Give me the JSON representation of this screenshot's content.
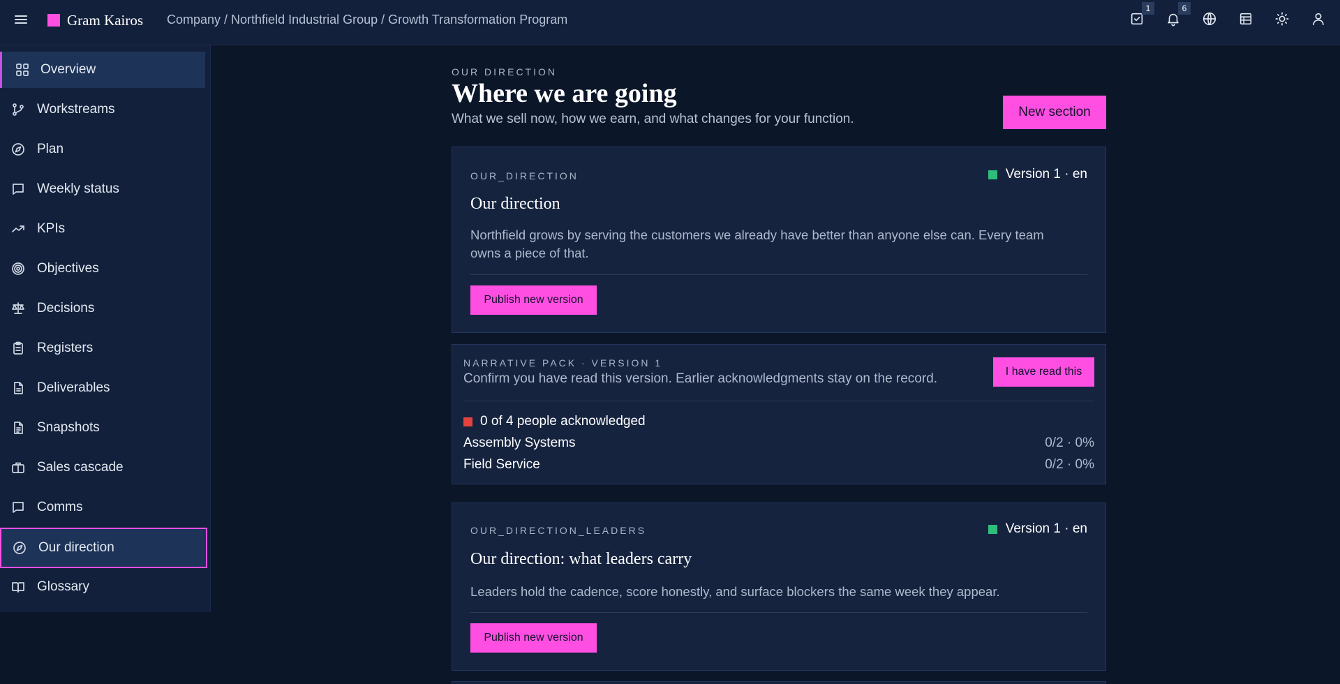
{
  "header": {
    "brand": "Gram Kairos",
    "breadcrumb": "Company / Northfield Industrial Group / Growth Transformation Program",
    "tasks_count": "1",
    "notifications_count": "6"
  },
  "sidebar": {
    "items": [
      {
        "label": "Overview",
        "icon": "grid-icon"
      },
      {
        "label": "Workstreams",
        "icon": "branch-icon"
      },
      {
        "label": "Plan",
        "icon": "compass-icon"
      },
      {
        "label": "Weekly status",
        "icon": "message-icon"
      },
      {
        "label": "KPIs",
        "icon": "trending-up-icon"
      },
      {
        "label": "Objectives",
        "icon": "target-icon"
      },
      {
        "label": "Decisions",
        "icon": "scale-icon"
      },
      {
        "label": "Registers",
        "icon": "clipboard-icon"
      },
      {
        "label": "Deliverables",
        "icon": "file-icon"
      },
      {
        "label": "Snapshots",
        "icon": "file-text-icon"
      },
      {
        "label": "Sales cascade",
        "icon": "briefcase-icon"
      },
      {
        "label": "Comms",
        "icon": "message-icon"
      },
      {
        "label": "Our direction",
        "icon": "compass-icon"
      },
      {
        "label": "Glossary",
        "icon": "book-open-icon"
      }
    ]
  },
  "page": {
    "eyebrow": "OUR DIRECTION",
    "title": "Where we are going",
    "subtitle": "What we sell now, how we earn, and what changes for your function.",
    "new_section_label": "New section"
  },
  "cards": [
    {
      "key": "OUR_DIRECTION",
      "version": "Version 1 · en",
      "title": "Our direction",
      "body": "Northfield grows by serving the customers we already have better than anyone else can. Every team owns a piece of that.",
      "publish_label": "Publish new version"
    },
    {
      "key": "OUR_DIRECTION_LEADERS",
      "version": "Version 1 · en",
      "title": "Our direction: what leaders carry",
      "body": "Leaders hold the cadence, score honestly, and surface blockers the same week they appear.",
      "publish_label": "Publish new version"
    }
  ],
  "acknowledgment": {
    "eyebrow": "NARRATIVE PACK · VERSION 1",
    "text": "Confirm you have read this version. Earlier acknowledgments stay on the record.",
    "button_label": "I have read this",
    "summary": "0 of 4 people acknowledged",
    "rows": [
      {
        "name": "Assembly Systems",
        "value": "0/2 · 0%"
      },
      {
        "name": "Field Service",
        "value": "0/2 · 0%"
      }
    ]
  },
  "colors": {
    "accent": "#ff4fe3",
    "background": "#0b1629",
    "panel": "#15233f",
    "status_ok": "#2ebd7a",
    "status_alert": "#e4423e"
  }
}
